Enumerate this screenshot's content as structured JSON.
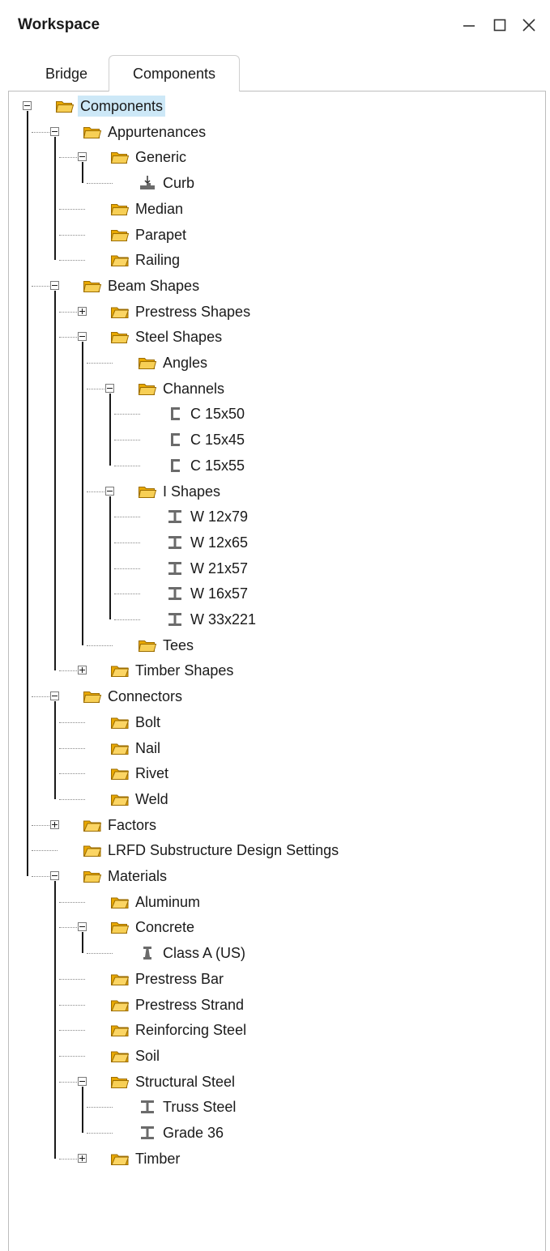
{
  "window": {
    "title": "Workspace",
    "controls": [
      "minimize-icon",
      "maximize-icon",
      "close-icon"
    ]
  },
  "tabs": [
    {
      "label": "Bridge",
      "active": false
    },
    {
      "label": "Components",
      "active": true
    }
  ],
  "colors": {
    "selection": "#cde8f7",
    "folder_open": "#f5c542",
    "folder_closed": "#f2b705",
    "shape_icon": "#6b6b6b"
  },
  "tree": [
    {
      "label": "Components",
      "icon": "folder-open-icon",
      "level": 0,
      "toggle": "minus",
      "selected": true
    },
    {
      "label": "Appurtenances",
      "icon": "folder-open-icon",
      "level": 1,
      "toggle": "minus"
    },
    {
      "label": "Generic",
      "icon": "folder-open-icon",
      "level": 2,
      "toggle": "minus"
    },
    {
      "label": "Curb",
      "icon": "curb-icon",
      "level": 3
    },
    {
      "label": "Median",
      "icon": "folder-open-icon",
      "level": 2
    },
    {
      "label": "Parapet",
      "icon": "folder-open-icon",
      "level": 2
    },
    {
      "label": "Railing",
      "icon": "folder-closed-icon",
      "level": 2
    },
    {
      "label": "Beam Shapes",
      "icon": "folder-open-icon",
      "level": 1,
      "toggle": "minus"
    },
    {
      "label": "Prestress Shapes",
      "icon": "folder-closed-icon",
      "level": 2,
      "toggle": "plus"
    },
    {
      "label": "Steel Shapes",
      "icon": "folder-open-icon",
      "level": 2,
      "toggle": "minus"
    },
    {
      "label": "Angles",
      "icon": "folder-open-icon",
      "level": 3
    },
    {
      "label": "Channels",
      "icon": "folder-open-icon",
      "level": 3,
      "toggle": "minus"
    },
    {
      "label": "C 15x50",
      "icon": "channel-shape-icon",
      "level": 4
    },
    {
      "label": "C 15x45",
      "icon": "channel-shape-icon",
      "level": 4
    },
    {
      "label": "C 15x55",
      "icon": "channel-shape-icon",
      "level": 4
    },
    {
      "label": "I Shapes",
      "icon": "folder-open-icon",
      "level": 3,
      "toggle": "minus"
    },
    {
      "label": "W 12x79",
      "icon": "i-beam-icon",
      "level": 4
    },
    {
      "label": "W 12x65",
      "icon": "i-beam-icon",
      "level": 4
    },
    {
      "label": "W 21x57",
      "icon": "i-beam-icon",
      "level": 4
    },
    {
      "label": "W 16x57",
      "icon": "i-beam-icon",
      "level": 4
    },
    {
      "label": "W 33x221",
      "icon": "i-beam-icon",
      "level": 4
    },
    {
      "label": "Tees",
      "icon": "folder-open-icon",
      "level": 3
    },
    {
      "label": "Timber Shapes",
      "icon": "folder-closed-icon",
      "level": 2,
      "toggle": "plus"
    },
    {
      "label": "Connectors",
      "icon": "folder-open-icon",
      "level": 1,
      "toggle": "minus"
    },
    {
      "label": "Bolt",
      "icon": "folder-closed-icon",
      "level": 2
    },
    {
      "label": "Nail",
      "icon": "folder-closed-icon",
      "level": 2
    },
    {
      "label": "Rivet",
      "icon": "folder-closed-icon",
      "level": 2
    },
    {
      "label": "Weld",
      "icon": "folder-closed-icon",
      "level": 2
    },
    {
      "label": "Factors",
      "icon": "folder-closed-icon",
      "level": 1,
      "toggle": "plus"
    },
    {
      "label": "LRFD Substructure Design Settings",
      "icon": "folder-closed-icon",
      "level": 1
    },
    {
      "label": "Materials",
      "icon": "folder-open-icon",
      "level": 1,
      "toggle": "minus"
    },
    {
      "label": "Aluminum",
      "icon": "folder-closed-icon",
      "level": 2
    },
    {
      "label": "Concrete",
      "icon": "folder-open-icon",
      "level": 2,
      "toggle": "minus"
    },
    {
      "label": "Class A (US)",
      "icon": "concrete-material-icon",
      "level": 3
    },
    {
      "label": "Prestress Bar",
      "icon": "folder-closed-icon",
      "level": 2
    },
    {
      "label": "Prestress Strand",
      "icon": "folder-closed-icon",
      "level": 2
    },
    {
      "label": "Reinforcing Steel",
      "icon": "folder-closed-icon",
      "level": 2
    },
    {
      "label": "Soil",
      "icon": "folder-closed-icon",
      "level": 2
    },
    {
      "label": "Structural Steel",
      "icon": "folder-open-icon",
      "level": 2,
      "toggle": "minus"
    },
    {
      "label": "Truss Steel",
      "icon": "steel-material-icon",
      "level": 3
    },
    {
      "label": "Grade 36",
      "icon": "steel-material-icon",
      "level": 3
    },
    {
      "label": "Timber",
      "icon": "folder-closed-icon",
      "level": 2,
      "toggle": "plus"
    }
  ]
}
